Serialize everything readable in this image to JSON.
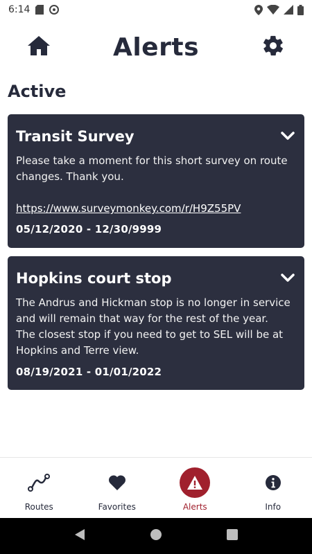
{
  "status_bar": {
    "time": "6:14",
    "left_icons": [
      "sd-card-icon",
      "at-sign-icon"
    ],
    "right_icons": [
      "location-icon",
      "wifi-icon",
      "signal-icon",
      "battery-icon"
    ]
  },
  "header": {
    "title": "Alerts",
    "left_icon": "home-icon",
    "right_icon": "gear-icon"
  },
  "section": {
    "title": "Active"
  },
  "alerts": [
    {
      "title": "Transit Survey",
      "body": "Please take a moment for this short survey on route changes. Thank you.",
      "link": "https://www.surveymonkey.com/r/H9Z55PV",
      "date_range": "05/12/2020 - 12/30/9999"
    },
    {
      "title": "Hopkins court stop",
      "body": "The Andrus and Hickman stop is no longer in service and will remain that way for the rest of the year.\nThe closest stop if you need to get to SEL will be at Hopkins and Terre view.",
      "date_range": "08/19/2021 - 01/01/2022"
    }
  ],
  "tabs": [
    {
      "label": "Routes",
      "icon": "route-icon",
      "active": false
    },
    {
      "label": "Favorites",
      "icon": "heart-icon",
      "active": false
    },
    {
      "label": "Alerts",
      "icon": "alert-icon",
      "active": true
    },
    {
      "label": "Info",
      "icon": "info-icon",
      "active": false
    }
  ],
  "colors": {
    "card_bg": "#2c2f3f",
    "accent": "#a0202d",
    "text_dark": "#262a3b"
  }
}
